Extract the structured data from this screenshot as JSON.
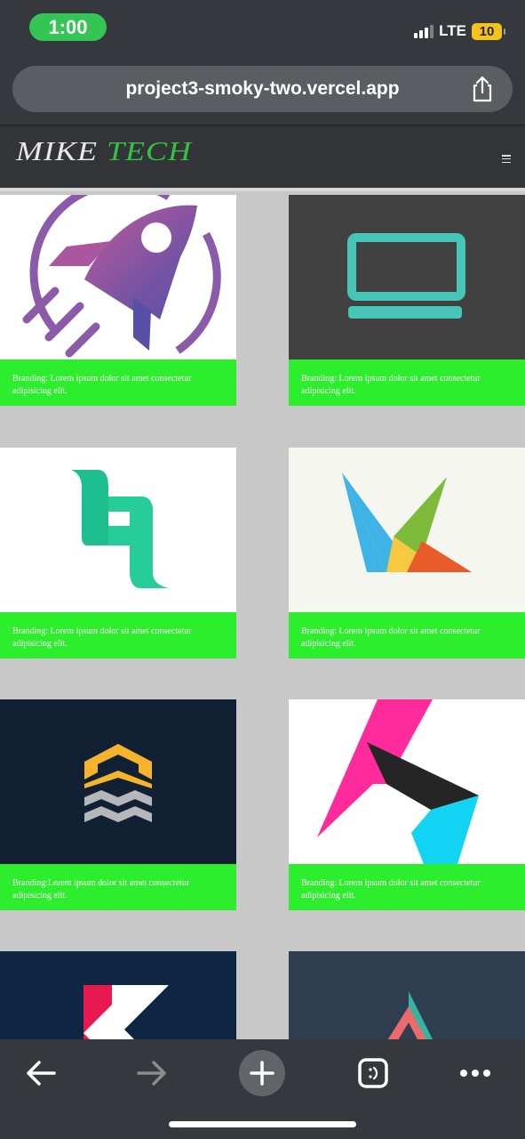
{
  "status_bar": {
    "time": "1:00",
    "network": "LTE",
    "battery": "10"
  },
  "browser": {
    "url": "project3-smoky-two.vercel.app"
  },
  "site": {
    "logo_first": "MIKE",
    "logo_second": "TECH"
  },
  "gallery": {
    "cards": [
      {
        "caption": "Branding: Lorem ipsum dolor sit amet consectetur adipisicing elit.",
        "image": "rocket-logo"
      },
      {
        "caption": "Branding: Lorem ipsum dolor sit amet consectetur adipisicing elit.",
        "image": "laptop-logo"
      },
      {
        "caption": "Branding: Lorem ipsum dolor sit amet consectetur adipisicing elit.",
        "image": "letter-q-logo"
      },
      {
        "caption": "Branding: Lorem ipsum dolor sit amet consectetur adipisicing elit.",
        "image": "bird-origami-logo"
      },
      {
        "caption": "Branding:Lorem ipsum dolor sit amet consectetur adipisicing elit.",
        "image": "stacked-chevrons-logo"
      },
      {
        "caption": "Branding: Lorem ipsum dolor sit amet consectetur adipisicing elit.",
        "image": "folded-k-logo"
      },
      {
        "caption": "",
        "image": "letter-k-logo"
      },
      {
        "caption": "",
        "image": "letter-a-logo"
      }
    ]
  },
  "colors": {
    "chrome": "#35383c",
    "time_pill": "#33c653",
    "battery": "#f4c21b",
    "site_header": "#333437",
    "logo_accent": "#33c342",
    "caption_bg": "#2dee2d",
    "page_bg": "#c8c8c8"
  },
  "icons": {
    "share": "share-icon",
    "menu": "hamburger-menu-icon",
    "back": "back-arrow-icon",
    "forward": "forward-arrow-icon",
    "new_tab": "plus-icon",
    "tabs": "tab-switcher-icon",
    "more": "more-dots-icon"
  }
}
